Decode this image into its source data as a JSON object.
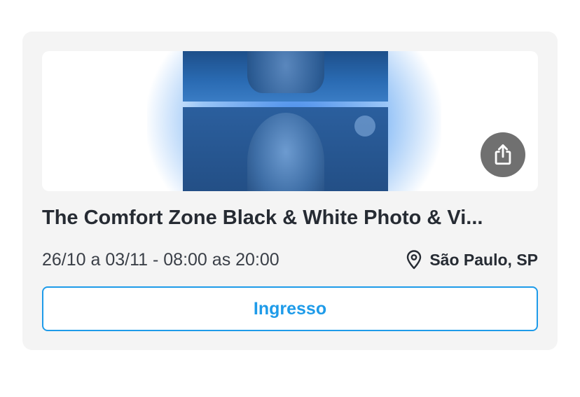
{
  "event": {
    "title": "The Comfort Zone  Black & White Photo & Vi...",
    "date_time": "26/10 a 03/11 - 08:00 as 20:00",
    "location": "São Paulo, SP",
    "ticket_label": "Ingresso"
  },
  "icons": {
    "share": "share-icon",
    "location": "location-pin-icon"
  },
  "colors": {
    "accent": "#1e9be9",
    "card_background": "#f4f4f4",
    "title_text": "#262b33",
    "share_button": "#707070",
    "banner_tint": "#2a6bb3"
  }
}
